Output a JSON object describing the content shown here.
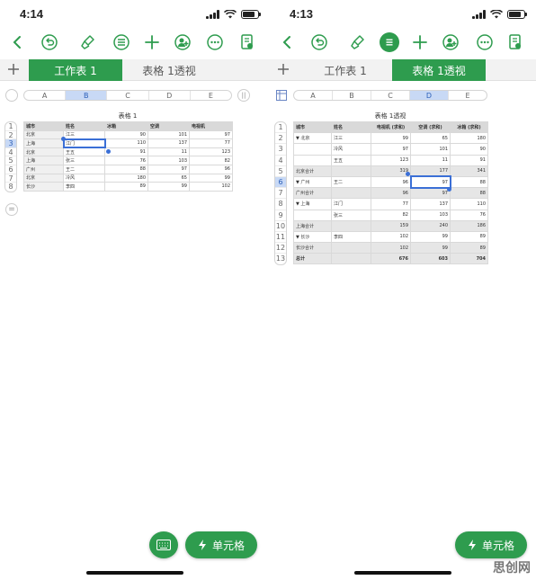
{
  "screens": [
    {
      "time": "4:14",
      "tabs": [
        {
          "label": "工作表 1",
          "active": true
        },
        {
          "label": "表格 1透视",
          "active": false
        }
      ],
      "columns": [
        "A",
        "B",
        "C",
        "D",
        "E"
      ],
      "selected_column": "B",
      "selected_row": "3",
      "rows": [
        "1",
        "2",
        "3",
        "4",
        "5",
        "6",
        "7",
        "8"
      ],
      "table_title": "表格 1",
      "table": {
        "headers": [
          "城市",
          "姓名",
          "冰箱",
          "空调",
          "电视机"
        ],
        "rows": [
          [
            "北京",
            "江三",
            "90",
            "101",
            "97"
          ],
          [
            "上海",
            "江门",
            "110",
            "137",
            "77"
          ],
          [
            "北京",
            "王五",
            "91",
            "11",
            "123"
          ],
          [
            "上海",
            "张三",
            "76",
            "103",
            "82"
          ],
          [
            "广州",
            "王二",
            "88",
            "97",
            "96"
          ],
          [
            "北京",
            "冷风",
            "180",
            "65",
            "99"
          ],
          [
            "长沙",
            "李四",
            "89",
            "99",
            "102"
          ]
        ]
      },
      "buttons": {
        "keyboard_label": "",
        "cell_label": "单元格"
      }
    },
    {
      "time": "4:13",
      "tabs": [
        {
          "label": "工作表 1",
          "active": false
        },
        {
          "label": "表格 1透视",
          "active": true
        }
      ],
      "columns": [
        "A",
        "B",
        "C",
        "D",
        "E"
      ],
      "selected_column": "D",
      "selected_row": "6",
      "rows": [
        "1",
        "2",
        "3",
        "4",
        "5",
        "6",
        "7",
        "8",
        "9",
        "10",
        "11",
        "12",
        "13"
      ],
      "table_title": "表格 1透视",
      "pivot": {
        "headers": [
          "城市",
          "姓名",
          "电视机 (求和)",
          "空调 (求和)",
          "冰箱 (求和)"
        ],
        "rows": [
          {
            "type": "data",
            "cells": [
              "▼ 北京",
              "江三",
              "99",
              "65",
              "180"
            ]
          },
          {
            "type": "data",
            "cells": [
              "",
              "冷风",
              "97",
              "101",
              "90"
            ]
          },
          {
            "type": "data",
            "cells": [
              "",
              "王五",
              "123",
              "11",
              "91"
            ]
          },
          {
            "type": "sub",
            "cells": [
              "北京合计",
              "",
              "319",
              "177",
              "341"
            ]
          },
          {
            "type": "data",
            "cells": [
              "▼ 广州",
              "王二",
              "96",
              "97",
              "88"
            ]
          },
          {
            "type": "sub",
            "cells": [
              "广州合计",
              "",
              "96",
              "97",
              "88"
            ]
          },
          {
            "type": "data",
            "cells": [
              "▼ 上海",
              "江门",
              "77",
              "137",
              "110"
            ]
          },
          {
            "type": "data",
            "cells": [
              "",
              "张三",
              "82",
              "103",
              "76"
            ]
          },
          {
            "type": "sub",
            "cells": [
              "上海合计",
              "",
              "159",
              "240",
              "186"
            ]
          },
          {
            "type": "data",
            "cells": [
              "▼ 长沙",
              "李四",
              "102",
              "99",
              "89"
            ]
          },
          {
            "type": "sub",
            "cells": [
              "长沙合计",
              "",
              "102",
              "99",
              "89"
            ]
          },
          {
            "type": "total",
            "cells": [
              "总计",
              "",
              "676",
              "603",
              "704"
            ]
          }
        ]
      },
      "buttons": {
        "cell_label": "单元格"
      }
    }
  ],
  "watermark": "思创网",
  "colors": {
    "accent": "#2e9c4e",
    "selection": "#3b6fd6",
    "column_highlight": "#c8d9f5"
  }
}
